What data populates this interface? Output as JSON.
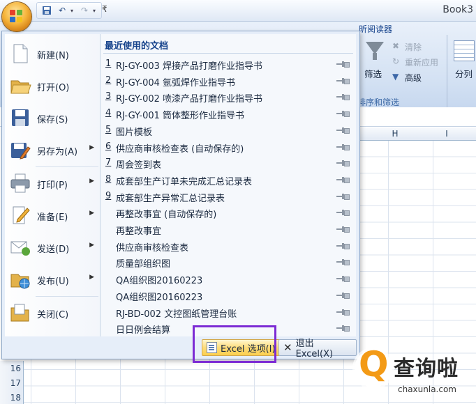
{
  "window": {
    "title": "Book3"
  },
  "ribbon": {
    "tab_label": "阅读器",
    "tab_label_prefix": "昕",
    "clear_label": "清除",
    "reapply_label": "重新应用",
    "advanced_label": "高级",
    "filter_label": "筛选",
    "split_label": "分列",
    "group_label": "排序和筛选"
  },
  "sheet": {
    "columns": [
      "H",
      "I"
    ],
    "rows": [
      "16",
      "17",
      "18"
    ]
  },
  "menu": {
    "left_items": [
      {
        "label": "新建(N)",
        "has_arrow": false,
        "icon": "new-document-icon"
      },
      {
        "label": "打开(O)",
        "has_arrow": false,
        "icon": "open-folder-icon"
      },
      {
        "label": "保存(S)",
        "has_arrow": false,
        "icon": "save-disk-icon"
      },
      {
        "label": "另存为(A)",
        "has_arrow": true,
        "icon": "save-as-icon"
      },
      {
        "label": "打印(P)",
        "has_arrow": true,
        "icon": "printer-icon"
      },
      {
        "label": "准备(E)",
        "has_arrow": true,
        "icon": "prepare-icon"
      },
      {
        "label": "发送(D)",
        "has_arrow": true,
        "icon": "send-icon"
      },
      {
        "label": "发布(U)",
        "has_arrow": true,
        "icon": "publish-icon"
      },
      {
        "label": "关闭(C)",
        "has_arrow": false,
        "icon": "close-folder-icon"
      }
    ],
    "recent_title": "最近使用的文档",
    "recent_docs": [
      {
        "num": "1",
        "name": "RJ-GY-003 焊接产品打磨作业指导书"
      },
      {
        "num": "2",
        "name": "RJ-GY-004 氩弧焊作业指导书"
      },
      {
        "num": "3",
        "name": "RJ-GY-002 喷漆产品打磨作业指导书"
      },
      {
        "num": "4",
        "name": "RJ-GY-001 筒体整形作业指导书"
      },
      {
        "num": "5",
        "name": "图片模板"
      },
      {
        "num": "6",
        "name": "供应商审核检查表 (自动保存的)"
      },
      {
        "num": "7",
        "name": "周会签到表"
      },
      {
        "num": "8",
        "name": "成套部生产订单未完成汇总记录表"
      },
      {
        "num": "9",
        "name": "成套部生产异常汇总记录表"
      },
      {
        "num": "",
        "name": "再整改事宜 (自动保存的)"
      },
      {
        "num": "",
        "name": "再整改事宜"
      },
      {
        "num": "",
        "name": "供应商审核检查表"
      },
      {
        "num": "",
        "name": "质量部组织图"
      },
      {
        "num": "",
        "name": "QA组织图20160223"
      },
      {
        "num": "",
        "name": "QA组织图20160223"
      },
      {
        "num": "",
        "name": "RJ-BD-002 文控图纸管理台账"
      },
      {
        "num": "",
        "name": "日日例会结算"
      }
    ],
    "options_button": "Excel 选项(I)",
    "exit_button": "退出 Excel(X)"
  },
  "watermark": {
    "name": "查询啦",
    "url": "chaxunla.com"
  },
  "colors": {
    "highlight": "#7c2bd4",
    "accent": "#15428b",
    "watermark_orange": "#f39a16"
  }
}
